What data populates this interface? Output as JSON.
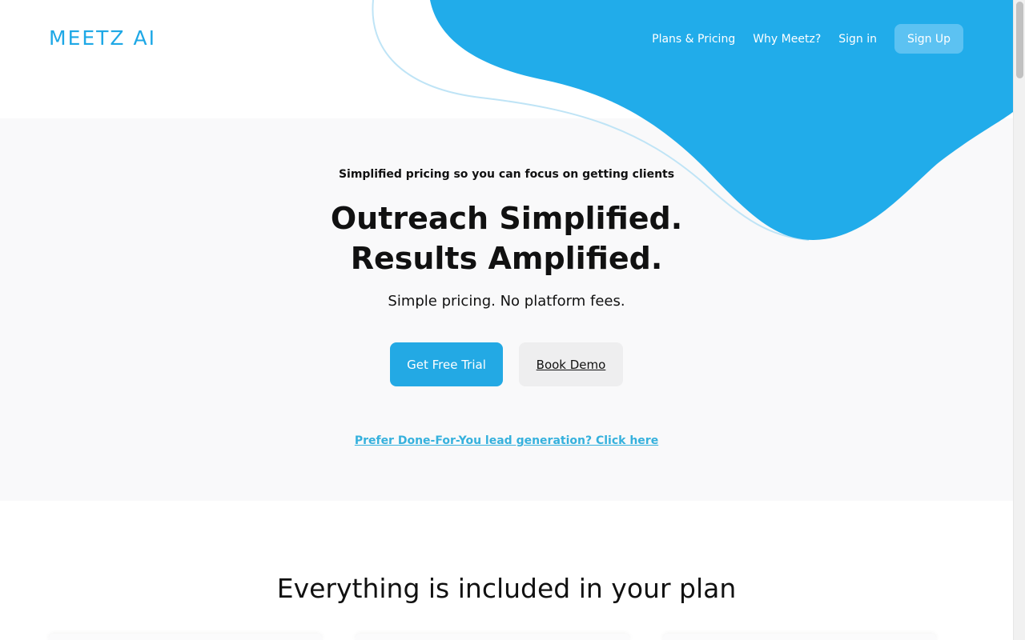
{
  "brand": {
    "logo_text": "MEETZ AI",
    "primary_color": "#1ea8e6",
    "blob_color": "#21acea",
    "hero_band_color": "#f9f9fa"
  },
  "nav": {
    "items": [
      {
        "label": "Plans & Pricing"
      },
      {
        "label": "Why Meetz?"
      },
      {
        "label": "Sign in"
      }
    ],
    "signup_label": "Sign Up"
  },
  "hero": {
    "kicker": "Simplified pricing so you can focus on getting clients",
    "title_line1": "Outreach Simplified.",
    "title_line2": "Results Amplified.",
    "subtitle": "Simple pricing. No platform fees.",
    "primary_cta": "Get Free Trial",
    "secondary_cta": "Book Demo",
    "dfy_link": "Prefer Done-For-You lead generation? Click here"
  },
  "features": {
    "title": "Everything is included in your plan"
  }
}
